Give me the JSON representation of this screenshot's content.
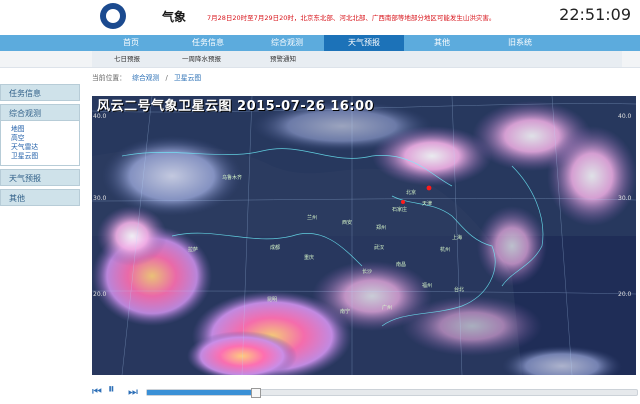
{
  "header": {
    "brand": "气象",
    "alert": "7月28日20时至7月29日20时，北京东北部、河北北部、广西南部等地部分地区可能发生山洪灾害。",
    "clock": "22:51:09"
  },
  "nav": {
    "items": [
      "首页",
      "任务信息",
      "综合观测",
      "天气预报",
      "其他",
      "旧系统"
    ],
    "active": "天气预报"
  },
  "subnav": {
    "items": [
      "七日预报",
      "一周降水预报",
      "预警通知"
    ]
  },
  "breadcrumb": {
    "label": "当前位置：",
    "path": [
      "综合观测",
      "卫星云图"
    ],
    "sep": "/"
  },
  "sidebar": {
    "headers": [
      "任务信息",
      "综合观测",
      "天气预报",
      "其他"
    ],
    "links": [
      "地图",
      "高空",
      "天气雷达",
      "卫星云图"
    ]
  },
  "map": {
    "title": "风云二号气象卫星云图  2015-07-26 16:00",
    "lat_labels": [
      "40.0",
      "30.0",
      "20.0",
      "40.0",
      "30.0",
      "20.0"
    ],
    "cities": [
      "北京",
      "天津",
      "石家庄",
      "西安",
      "成都",
      "武汉",
      "重庆",
      "长沙",
      "南昌",
      "福州",
      "广州",
      "南宁",
      "昆明",
      "拉萨",
      "乌鲁木齐",
      "兰州",
      "郑州",
      "杭州",
      "上海",
      "台北"
    ]
  },
  "player": {
    "progress": 0.22,
    "prev_icon": "prev-icon",
    "play_icon": "pause-icon",
    "next_icon": "next-icon"
  }
}
